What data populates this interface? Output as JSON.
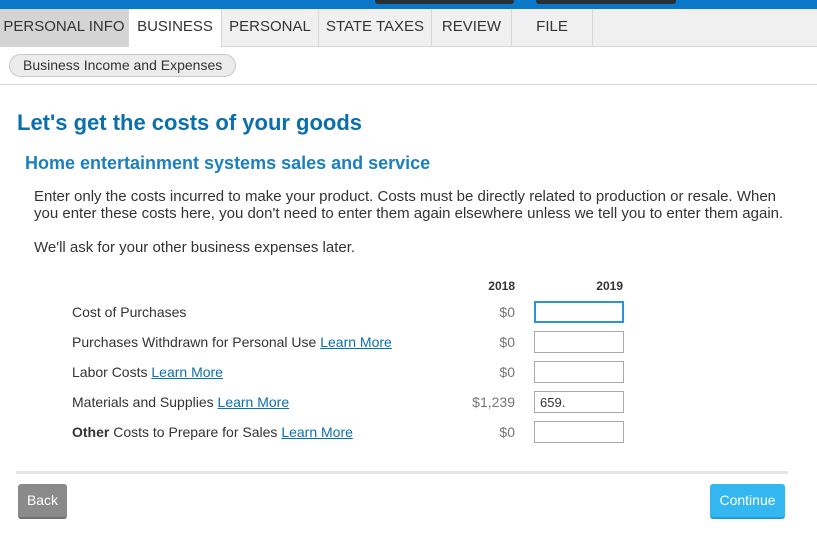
{
  "tabs": [
    {
      "label": "PERSONAL INFO",
      "state": "done"
    },
    {
      "label": "BUSINESS",
      "state": "active"
    },
    {
      "label": "PERSONAL",
      "state": "normal"
    },
    {
      "label": "STATE TAXES",
      "state": "normal"
    },
    {
      "label": "REVIEW",
      "state": "normal"
    },
    {
      "label": "FILE",
      "state": "normal"
    }
  ],
  "breadcrumb": {
    "label": "Business Income and Expenses"
  },
  "page": {
    "title": "Let's get the costs of your goods",
    "subtitle": "Home entertainment systems sales and service",
    "intro": "Enter only the costs incurred to make your product. Costs must be directly related to production or resale. When you enter these costs here, you don't need to enter them again elsewhere unless we tell you to enter them again.",
    "note": "We'll ask for your other business expenses later."
  },
  "table": {
    "year_prev": "2018",
    "year_curr": "2019",
    "learn_more": "Learn More",
    "rows": [
      {
        "label": "Cost of Purchases",
        "label_bold": "",
        "label_rest": "",
        "has_learn_more": false,
        "prev": "$0",
        "value": ""
      },
      {
        "label": "Purchases Withdrawn for Personal Use",
        "label_bold": "",
        "label_rest": "",
        "has_learn_more": true,
        "prev": "$0",
        "value": ""
      },
      {
        "label": "Labor Costs",
        "label_bold": "",
        "label_rest": "",
        "has_learn_more": true,
        "prev": "$0",
        "value": ""
      },
      {
        "label": "Materials and Supplies",
        "label_bold": "",
        "label_rest": "",
        "has_learn_more": true,
        "prev": "$1,239",
        "value": "659."
      },
      {
        "label": "",
        "label_bold": "Other",
        "label_rest": " Costs to Prepare for Sales",
        "has_learn_more": true,
        "prev": "$0",
        "value": ""
      }
    ]
  },
  "footer": {
    "back_label": "Back",
    "continue_label": "Continue"
  },
  "colors": {
    "accent": "#0b6fae",
    "continue": "#34b6f1",
    "back": "#8a8a8a",
    "topbar": "#0a77c9"
  }
}
